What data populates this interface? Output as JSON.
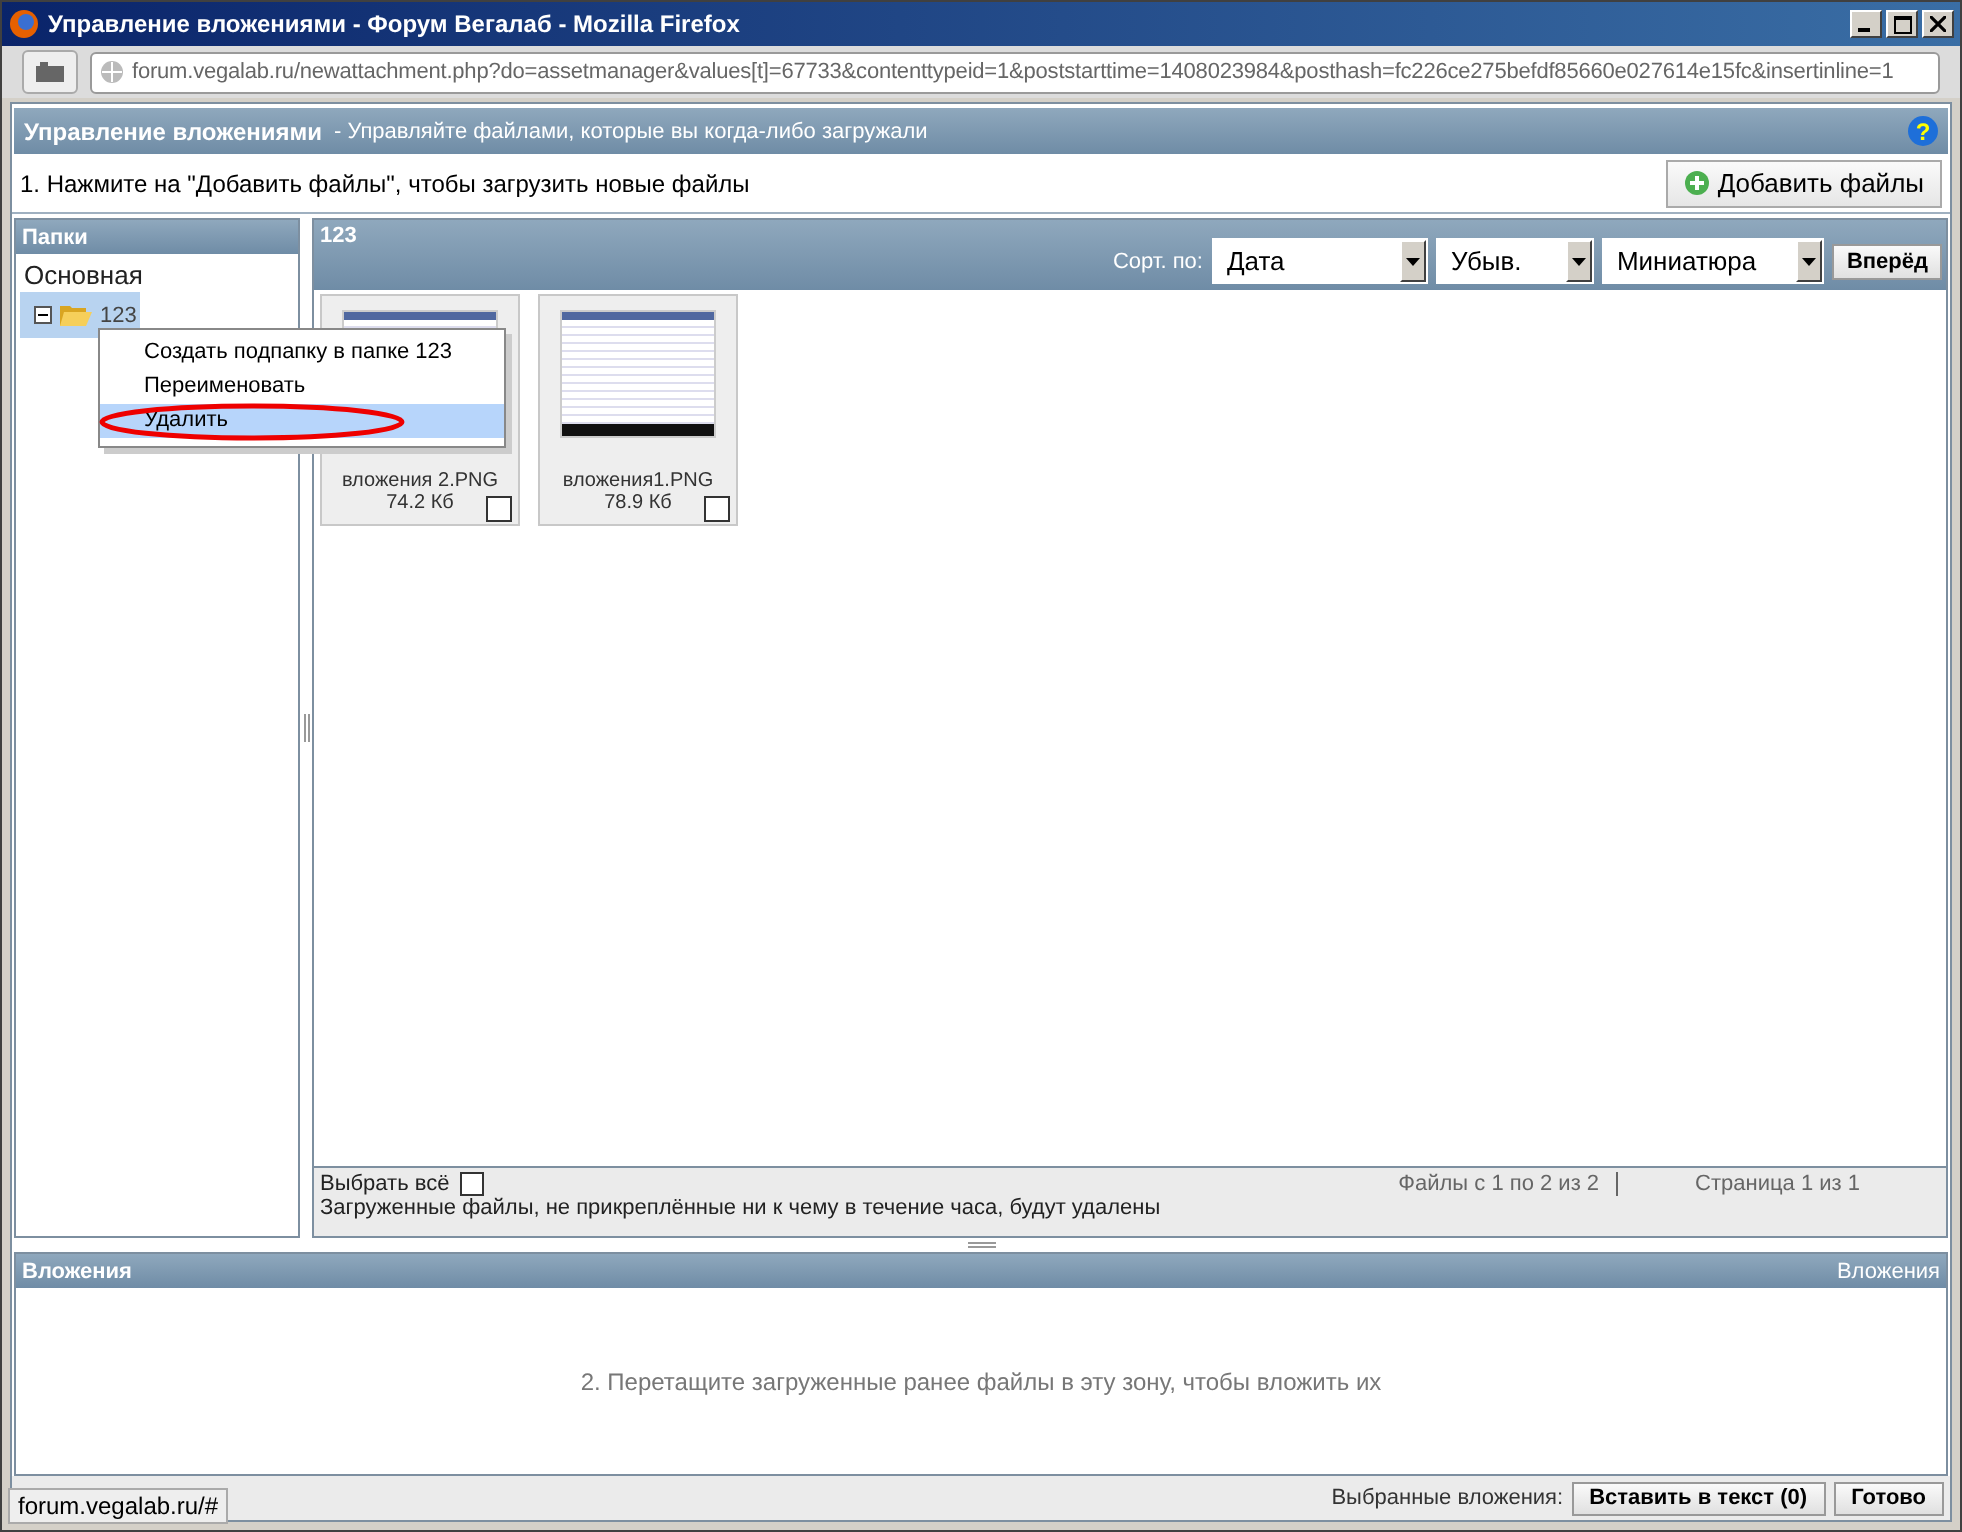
{
  "window": {
    "title": "Управление вложениями - Форум Вегалаб - Mozilla Firefox"
  },
  "address_bar": {
    "url": "forum.vegalab.ru/newattachment.php?do=assetmanager&values[t]=67733&contenttypeid=1&poststarttime=1408023984&posthash=fc226ce275befdf85660e027614e15fc&insertinline=1"
  },
  "header": {
    "title": "Управление вложениями",
    "subtitle": "- Управляйте файлами, которые вы когда-либо загружали",
    "help": "?"
  },
  "instruction": "1. Нажмите на \"Добавить файлы\", чтобы загрузить новые файлы",
  "add_button": "Добавить файлы",
  "folders": {
    "title": "Папки",
    "items": [
      {
        "label": "Основная",
        "selected": false
      },
      {
        "label": "123",
        "selected": true,
        "expanded": true
      }
    ]
  },
  "context_menu": [
    {
      "label": "Создать подпапку в папке 123",
      "selected": false
    },
    {
      "label": "Переименовать",
      "selected": false
    },
    {
      "label": "Удалить",
      "selected": true
    }
  ],
  "files_panel": {
    "title": "123",
    "sort_label": "Сорт. по:",
    "selects": [
      "Дата",
      "Убыв.",
      "Миниатюра"
    ],
    "go_button": "Вперёд"
  },
  "files": [
    {
      "name": "вложения 2.PNG",
      "size": "74.2 Кб",
      "checked": false
    },
    {
      "name": "вложения1.PNG",
      "size": "78.9 Кб",
      "checked": false
    }
  ],
  "files_footer": {
    "select_all": "Выбрать всё",
    "select_all_checked": false,
    "note": "Загруженные файлы, не прикреплённые ни к чему в течение часа, будут удалены",
    "range": "Файлы с 1 по 2 из 2",
    "page": "Страница 1 из 1"
  },
  "attachments": {
    "title": "Вложения",
    "right_label": "Вложения",
    "hint": "2. Перетащите загруженные ранее файлы в эту зону, чтобы вложить их"
  },
  "footer": {
    "label": "Выбранные вложения:",
    "insert_button": "Вставить в текст (0)",
    "done_button": "Готово"
  },
  "status_url": "forum.vegalab.ru/#"
}
